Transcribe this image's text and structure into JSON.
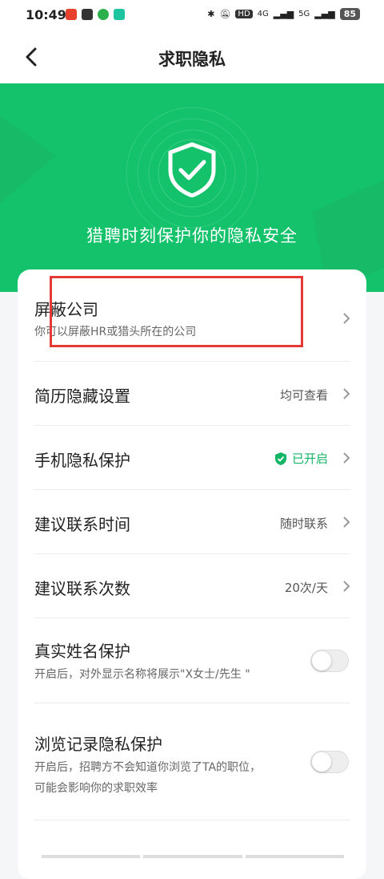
{
  "status_bar": {
    "time": "10:49",
    "signal_4g": "4G",
    "signal_5g": "5G",
    "hd": "HD",
    "battery": "85"
  },
  "header": {
    "title": "求职隐私"
  },
  "hero": {
    "title": "猎聘时刻保护你的隐私安全"
  },
  "settings": {
    "block_company": {
      "label": "屏蔽公司",
      "sub": "你可以屏蔽HR或猎头所在的公司"
    },
    "resume_hide": {
      "label": "简历隐藏设置",
      "value": "均可查看"
    },
    "phone_privacy": {
      "label": "手机隐私保护",
      "value": "已开启"
    },
    "contact_time": {
      "label": "建议联系时间",
      "value": "随时联系"
    },
    "contact_count": {
      "label": "建议联系次数",
      "value": "20次/天"
    },
    "real_name": {
      "label": "真实姓名保护",
      "sub": "开启后，对外显示名称将展示\"X女士/先生 \"",
      "enabled": false
    },
    "browse_history": {
      "label": "浏览记录隐私保护",
      "sub_line1": "开启后，招聘方不会知道你浏览了TA的职位，",
      "sub_line2": "可能会影响你的求职效率",
      "enabled": false
    }
  },
  "colors": {
    "brand_green": "#13c26a",
    "highlight_red": "#e53935"
  }
}
